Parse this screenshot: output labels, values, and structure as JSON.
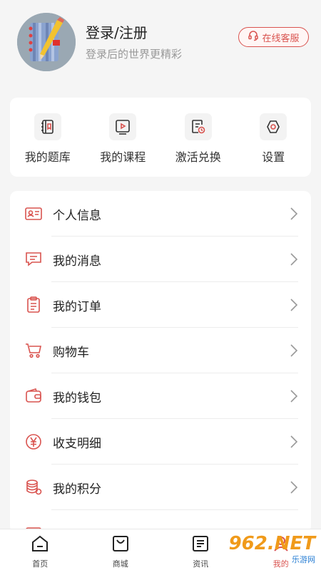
{
  "profile": {
    "login_title": "登录/注册",
    "login_subtitle": "登录后的世界更精彩",
    "service_label": "在线客服"
  },
  "quick_actions": [
    {
      "label": "我的题库",
      "icon": "question-bank-icon"
    },
    {
      "label": "我的课程",
      "icon": "course-play-icon"
    },
    {
      "label": "激活兑换",
      "icon": "activate-redeem-icon"
    },
    {
      "label": "设置",
      "icon": "settings-icon"
    }
  ],
  "menu": [
    {
      "label": "个人信息",
      "icon": "id-card-icon"
    },
    {
      "label": "我的消息",
      "icon": "message-icon"
    },
    {
      "label": "我的订单",
      "icon": "order-clipboard-icon"
    },
    {
      "label": "购物车",
      "icon": "cart-icon"
    },
    {
      "label": "我的钱包",
      "icon": "wallet-icon"
    },
    {
      "label": "收支明细",
      "icon": "yen-icon"
    },
    {
      "label": "我的积分",
      "icon": "coins-icon"
    }
  ],
  "tabbar": [
    {
      "label": "首页",
      "icon": "home-icon"
    },
    {
      "label": "商城",
      "icon": "shop-bag-icon"
    },
    {
      "label": "资讯",
      "icon": "news-icon"
    },
    {
      "label": "我的",
      "icon": "profile-icon"
    }
  ],
  "watermark": {
    "main": "962.NET",
    "sub": "乐游网"
  },
  "colors": {
    "accent": "#d9534f",
    "background": "#f5f5f5",
    "card": "#ffffff"
  }
}
